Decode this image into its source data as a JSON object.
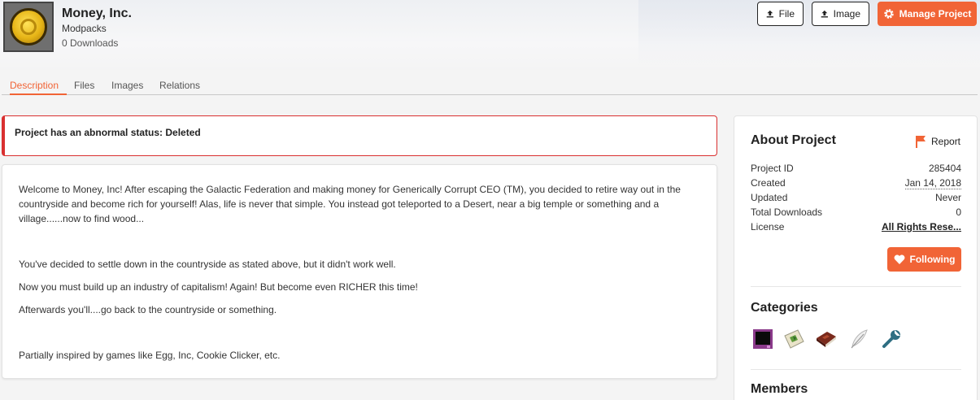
{
  "project": {
    "title": "Money, Inc.",
    "type": "Modpacks",
    "downloads": "0 Downloads"
  },
  "header": {
    "file_label": "File",
    "image_label": "Image",
    "manage_label": "Manage Project"
  },
  "tabs": [
    {
      "label": "Description",
      "active": true
    },
    {
      "label": "Files",
      "active": false
    },
    {
      "label": "Images",
      "active": false
    },
    {
      "label": "Relations",
      "active": false
    }
  ],
  "alert": {
    "text": "Project has an abnormal status: Deleted"
  },
  "description": {
    "paragraphs": [
      "Welcome to Money, Inc! After escaping the Galactic Federation and making money for Generically Corrupt CEO (TM), you decided to retire way out in the countryside and become rich for yourself! Alas, life is never that simple. You instead got teleported to a Desert, near a big temple or something and a village......now to find wood...",
      "You've decided to settle down in the countryside as stated above, but it didn't work well.",
      "Now you must build up an industry of capitalism! Again! But become even RICHER this time!",
      "Afterwards you'll....go back to the countryside or something.",
      "Partially inspired by games like Egg, Inc, Cookie Clicker, etc."
    ]
  },
  "about": {
    "title": "About Project",
    "report_label": "Report",
    "rows": [
      {
        "key": "Project ID",
        "value": "285404"
      },
      {
        "key": "Created",
        "value": "Jan 14, 2018"
      },
      {
        "key": "Updated",
        "value": "Never"
      },
      {
        "key": "Total Downloads",
        "value": "0"
      },
      {
        "key": "License",
        "value": "All Rights Rese..."
      }
    ],
    "following_label": "Following"
  },
  "categories": {
    "title": "Categories",
    "icons": [
      "dark-portal-icon",
      "map-icon",
      "book-icon",
      "feather-icon",
      "wrench-icon"
    ]
  },
  "members": {
    "title": "Members"
  },
  "colors": {
    "accent": "#f16436",
    "alert": "#d93030"
  }
}
